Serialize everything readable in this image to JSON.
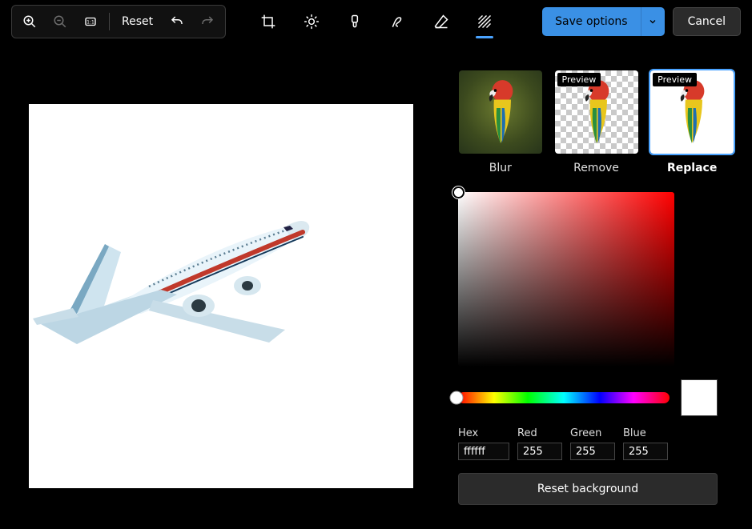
{
  "toolbar": {
    "reset_label": "Reset",
    "save_options_label": "Save options",
    "cancel_label": "Cancel"
  },
  "background_panel": {
    "options": [
      {
        "label": "Blur",
        "preview_badge": null
      },
      {
        "label": "Remove",
        "preview_badge": "Preview"
      },
      {
        "label": "Replace",
        "preview_badge": "Preview"
      }
    ],
    "selected_index": 2,
    "reset_label": "Reset background"
  },
  "color": {
    "fields": {
      "hex": {
        "label": "Hex",
        "value": "ffffff"
      },
      "red": {
        "label": "Red",
        "value": "255"
      },
      "green": {
        "label": "Green",
        "value": "255"
      },
      "blue": {
        "label": "Blue",
        "value": "255"
      }
    },
    "current_hex": "#ffffff",
    "hue_deg": 0
  }
}
